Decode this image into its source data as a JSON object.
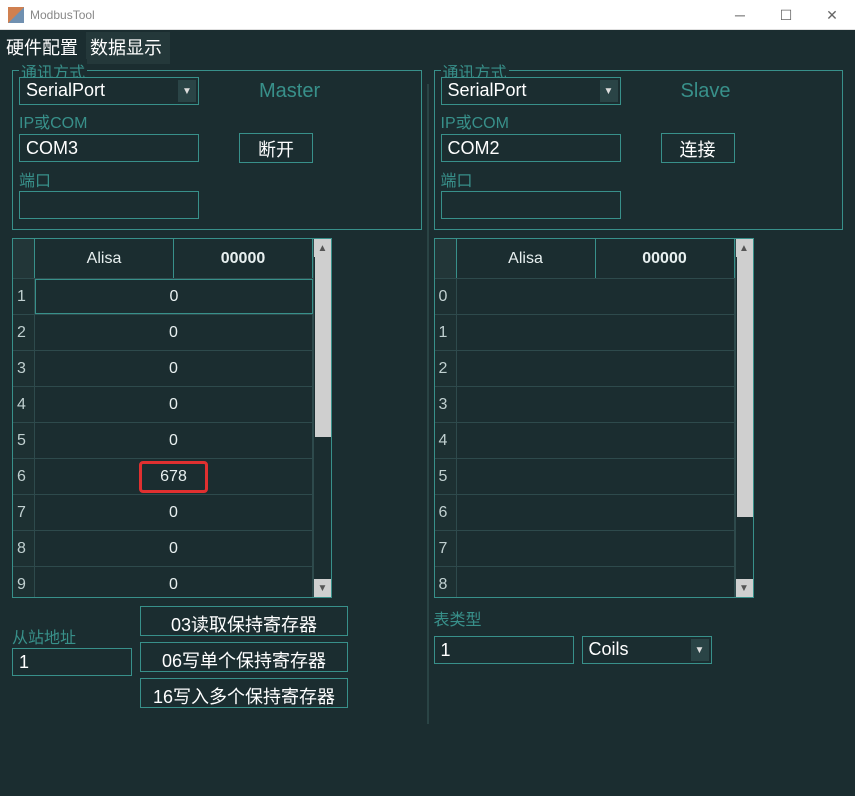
{
  "window": {
    "title": "ModbusTool"
  },
  "menu": {
    "hwconfig": "硬件配置",
    "datadisplay": "数据显示"
  },
  "left": {
    "commtype_label": "通讯方式",
    "commtype_value": "SerialPort",
    "role": "Master",
    "ipcom_label": "IP或COM",
    "ipcom_value": "COM3",
    "port_label": "端口",
    "port_value": "",
    "disconnect_btn": "断开",
    "table": {
      "colA": "Alisa",
      "colB": "00000",
      "rows": [
        {
          "n": "1",
          "a": "",
          "v": "0"
        },
        {
          "n": "2",
          "a": "",
          "v": "0"
        },
        {
          "n": "3",
          "a": "",
          "v": "0"
        },
        {
          "n": "4",
          "a": "",
          "v": "0"
        },
        {
          "n": "5",
          "a": "",
          "v": "0"
        },
        {
          "n": "6",
          "a": "",
          "v": "678"
        },
        {
          "n": "7",
          "a": "",
          "v": "0"
        },
        {
          "n": "8",
          "a": "",
          "v": "0"
        },
        {
          "n": "9",
          "a": "",
          "v": "0"
        }
      ]
    },
    "slave_addr_label": "从站地址",
    "slave_addr_value": "1",
    "btn03": "03读取保持寄存器",
    "btn06": "06写单个保持寄存器",
    "btn16": "16写入多个保持寄存器"
  },
  "right": {
    "commtype_label": "通讯方式",
    "commtype_value": "SerialPort",
    "role": "Slave",
    "ipcom_label": "IP或COM",
    "ipcom_value": "COM2",
    "port_label": "端口",
    "port_value": "",
    "connect_btn": "连接",
    "table": {
      "colA": "Alisa",
      "colB": "00000",
      "rows": [
        {
          "n": "0"
        },
        {
          "n": "1"
        },
        {
          "n": "2"
        },
        {
          "n": "3"
        },
        {
          "n": "4"
        },
        {
          "n": "5"
        },
        {
          "n": "6"
        },
        {
          "n": "7"
        },
        {
          "n": "8"
        }
      ]
    },
    "tabletype_label": "表类型",
    "tabletype_index": "1",
    "tabletype_value": "Coils"
  }
}
